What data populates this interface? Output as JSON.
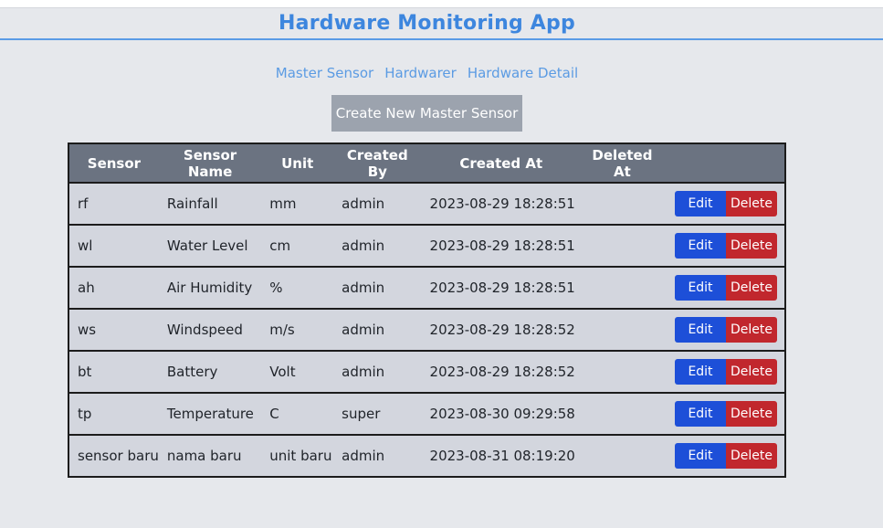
{
  "app": {
    "title": "Hardware Monitoring App"
  },
  "nav": [
    {
      "label": "Master Sensor"
    },
    {
      "label": "Hardwarer"
    },
    {
      "label": "Hardware Detail"
    }
  ],
  "actions": {
    "create_label": "Create New Master Sensor"
  },
  "table": {
    "headers": [
      "Sensor",
      "Sensor Name",
      "Unit",
      "Created By",
      "Created At",
      "Deleted At",
      ""
    ],
    "edit_label": "Edit",
    "delete_label": "Delete",
    "rows": [
      {
        "sensor": "rf",
        "name": "Rainfall",
        "unit": "mm",
        "created_by": "admin",
        "created_at": "2023-08-29 18:28:51",
        "deleted_at": ""
      },
      {
        "sensor": "wl",
        "name": "Water Level",
        "unit": "cm",
        "created_by": "admin",
        "created_at": "2023-08-29 18:28:51",
        "deleted_at": ""
      },
      {
        "sensor": "ah",
        "name": "Air Humidity",
        "unit": "%",
        "created_by": "admin",
        "created_at": "2023-08-29 18:28:51",
        "deleted_at": ""
      },
      {
        "sensor": "ws",
        "name": "Windspeed",
        "unit": "m/s",
        "created_by": "admin",
        "created_at": "2023-08-29 18:28:52",
        "deleted_at": ""
      },
      {
        "sensor": "bt",
        "name": "Battery",
        "unit": "Volt",
        "created_by": "admin",
        "created_at": "2023-08-29 18:28:52",
        "deleted_at": ""
      },
      {
        "sensor": "tp",
        "name": "Temperature",
        "unit": "C",
        "created_by": "super",
        "created_at": "2023-08-30 09:29:58",
        "deleted_at": ""
      },
      {
        "sensor": "sensor baru",
        "name": "nama baru",
        "unit": "unit baru",
        "created_by": "admin",
        "created_at": "2023-08-31 08:19:20",
        "deleted_at": ""
      }
    ]
  },
  "colors": {
    "title": "#3d86de",
    "nav_link": "#5b9be3",
    "edit": "#1d4fd8",
    "delete": "#c1272d",
    "header_bg": "#6b7381"
  }
}
